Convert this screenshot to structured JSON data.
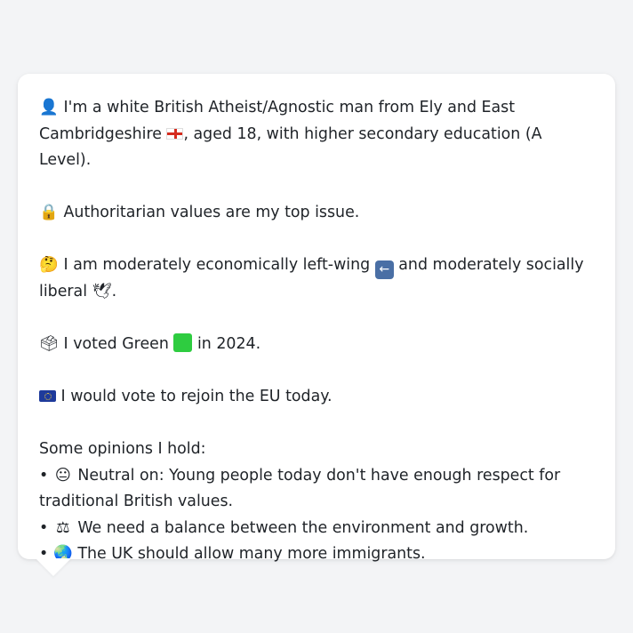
{
  "profile": {
    "intro": {
      "icon": "person-silhouette-icon",
      "text_before_flag": "I'm a white British Atheist/Agnostic man from Ely and East Cambridgeshire",
      "flag_icon": "england-flag-icon",
      "text_after_flag": ", aged 18, with higher secondary education (A Level)."
    },
    "top_issue": {
      "icon": "lock-icon",
      "text": "Authoritarian values are my top issue."
    },
    "politics": {
      "icon": "thinking-face-icon",
      "text_before_arrow": "I am moderately economically left-wing",
      "arrow_icon": "left-arrow-icon",
      "text_after_arrow": "and moderately socially liberal",
      "dove_icon": "dove-icon",
      "text_end": "."
    },
    "vote": {
      "icon": "ballot-box-icon",
      "text_before": "I voted Green",
      "green_icon": "green-square-icon",
      "text_after": "in 2024."
    },
    "eu": {
      "icon": "eu-flag-icon",
      "text": "I would vote to rejoin the EU today."
    },
    "opinions_heading": "Some opinions I hold:",
    "opinions": [
      {
        "bullet": "•",
        "icon": "neutral-face-icon",
        "text": "Neutral on: Young people today don't have enough respect for traditional British values."
      },
      {
        "bullet": "•",
        "icon": "scales-icon",
        "text": "We need a balance between the environment and growth."
      },
      {
        "bullet": "•",
        "icon": "globe-icon",
        "text": "The UK should allow many more immigrants."
      }
    ]
  },
  "colors": {
    "background": "#f3f4f6",
    "card": "#ffffff",
    "text": "#1f2328",
    "green": "#2ecc40"
  }
}
